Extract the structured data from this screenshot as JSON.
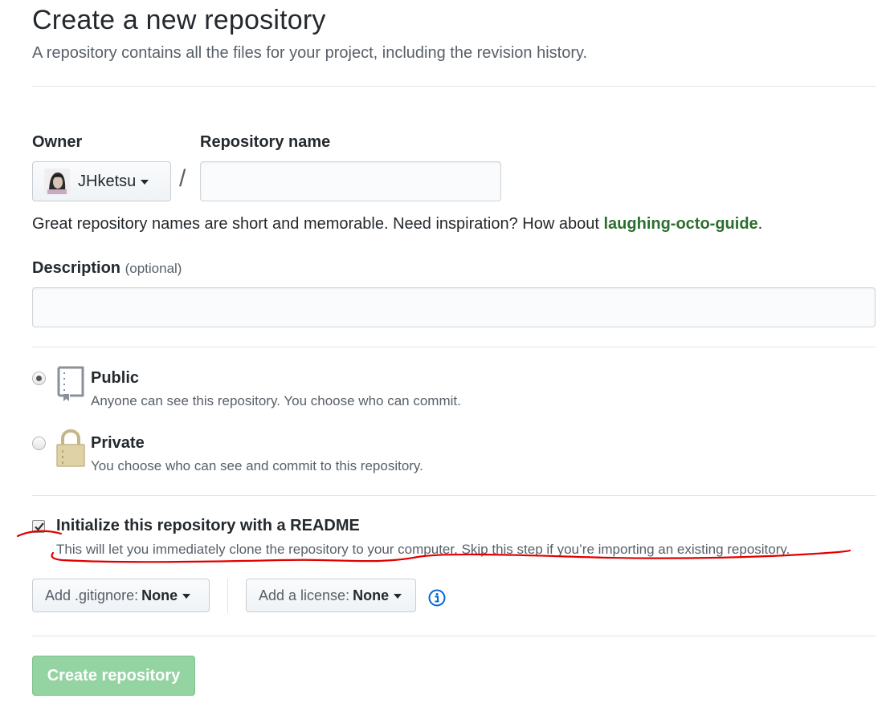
{
  "header": {
    "title": "Create a new repository",
    "subtitle": "A repository contains all the files for your project, including the revision history."
  },
  "owner": {
    "label": "Owner",
    "value": "JHketsu"
  },
  "repo_name": {
    "label": "Repository name",
    "separator": "/",
    "value": "",
    "placeholder": ""
  },
  "hint": {
    "text": "Great repository names are short and memorable. Need inspiration? How about ",
    "suggestion": "laughing-octo-guide",
    "end": "."
  },
  "description": {
    "label": "Description",
    "optional": "(optional)",
    "value": "",
    "placeholder": ""
  },
  "visibility": {
    "public": {
      "title": "Public",
      "desc": "Anyone can see this repository. You choose who can commit.",
      "checked": true
    },
    "private": {
      "title": "Private",
      "desc": "You choose who can see and commit to this repository.",
      "checked": false
    }
  },
  "readme": {
    "title": "Initialize this repository with a README",
    "desc": "This will let you immediately clone the repository to your computer. Skip this step if you’re importing an existing repository.",
    "checked": true
  },
  "gitignore": {
    "label": "Add .gitignore:",
    "value": "None"
  },
  "license": {
    "label": "Add a license:",
    "value": "None"
  },
  "submit": {
    "label": "Create repository"
  },
  "colors": {
    "link_green": "#2c6e2f",
    "button_disabled_green": "#94d3a2",
    "info_blue": "#0366d6",
    "annotation_red": "#e00000"
  }
}
